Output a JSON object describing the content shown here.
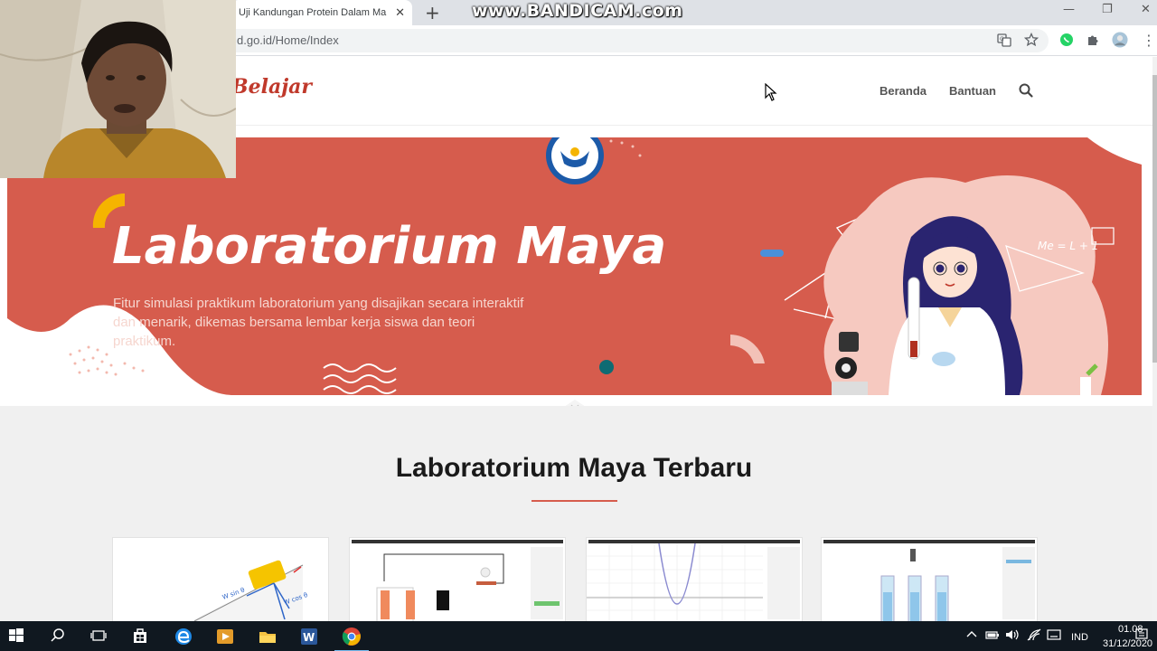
{
  "browser": {
    "tab_title": "Uji Kandungan Protein Dalam Ma",
    "tab_close": "✕",
    "new_tab": "+",
    "url": "d.go.id/Home/Index",
    "watermark": "www.BANDICAM.com",
    "window_minimize": "—",
    "window_restore": "❐",
    "window_close": "✕",
    "translate_icon": "translate-icon",
    "star_icon": "star-icon",
    "whatsapp_icon": "whatsapp-icon",
    "extensions_icon": "puzzle-icon",
    "menu_icon": "⋮"
  },
  "site": {
    "logo_text": "Belajar",
    "nav": [
      "Beranda",
      "Bantuan"
    ],
    "banner": {
      "title": "Laboratorium Maya",
      "description": "Fitur simulasi praktikum laboratorium yang disajikan secara interaktif dan menarik, dikemas bersama lembar kerja siswa dan teori praktikum.",
      "formula": "Me = L + 1"
    },
    "section_title": "Laboratorium Maya Terbaru",
    "card_labels": [
      "W sin θ",
      "W cos θ"
    ]
  },
  "colors": {
    "banner": "#d65c4d",
    "accent": "#d65c4d",
    "taskbar": "#101820"
  },
  "taskbar": {
    "language": "IND",
    "time": "01.08",
    "date": "31/12/2020"
  }
}
